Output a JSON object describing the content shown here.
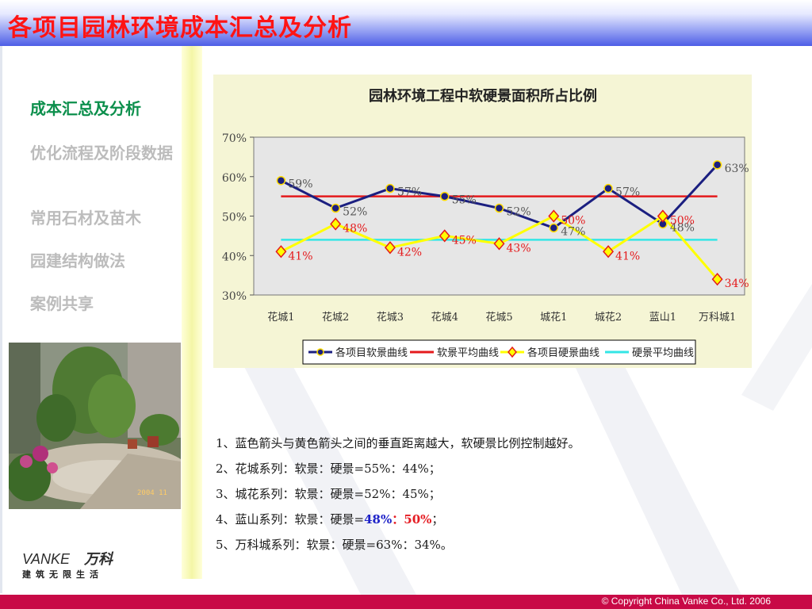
{
  "header": {
    "title": "各项目园林环境成本汇总及分析"
  },
  "nav": {
    "items": [
      {
        "label": "成本汇总及分析",
        "active": true
      },
      {
        "label": "优化流程及阶段数据",
        "active": false
      },
      {
        "label": "常用石材及苗木",
        "active": false
      },
      {
        "label": "园建结构做法",
        "active": false
      },
      {
        "label": "案例共享",
        "active": false
      }
    ]
  },
  "photo": {
    "date_stamp": "2004 11"
  },
  "logo": {
    "brand_latin": "VANKE",
    "brand_cn": "万科",
    "tagline": "建筑无限生活"
  },
  "chart_data": {
    "type": "line",
    "title": "园林环境工程中软硬景面积所占比例",
    "categories": [
      "花城1",
      "花城2",
      "花城3",
      "花城4",
      "花城5",
      "城花1",
      "城花2",
      "蓝山1",
      "万科城1"
    ],
    "ylim": [
      30,
      70
    ],
    "yticks": [
      "30%",
      "40%",
      "50%",
      "60%",
      "70%"
    ],
    "grid": false,
    "legend": "bottom",
    "series": [
      {
        "name": "各项目软景曲线",
        "values": [
          59,
          52,
          57,
          55,
          52,
          47,
          57,
          48,
          63
        ],
        "labels": [
          "59%",
          "52%",
          "57%",
          "55%",
          "52%",
          "47%",
          "57%",
          "48%",
          "63%"
        ],
        "color": "#1b1f80"
      },
      {
        "name": "软景平均曲线",
        "values": [
          55,
          55,
          55,
          55,
          55,
          55,
          55,
          55,
          55
        ],
        "color": "#e41a1c"
      },
      {
        "name": "各项目硬景曲线",
        "values": [
          41,
          48,
          42,
          45,
          43,
          50,
          41,
          50,
          34
        ],
        "labels": [
          "41%",
          "48%",
          "42%",
          "45%",
          "43%",
          "50%",
          "41%",
          "50%",
          "34%"
        ],
        "color": "#ffff00"
      },
      {
        "name": "硬景平均曲线",
        "values": [
          44,
          44,
          44,
          44,
          44,
          44,
          44,
          44,
          44
        ],
        "color": "#33e6e6"
      }
    ]
  },
  "notes": {
    "line1": "1、蓝色箭头与黄色箭头之间的垂直距离越大，软硬景比例控制越好。",
    "line2": "2、花城系列：软景：硬景=55%：44%；",
    "line3": "3、城花系列：软景：硬景=52%：45%；",
    "line4_prefix": "4、蓝山系列：软景：硬景=",
    "line4_soft": "48%",
    "line4_sep": "：",
    "line4_hard": "50%",
    "line4_suffix": "；",
    "line5": "5、万科城系列：软景：硬景=63%：34%。"
  },
  "footer": {
    "copyright": "© Copyright China Vanke Co., Ltd. 2006"
  },
  "colors": {
    "accent_red": "#ff1414",
    "nav_active": "#0c8f4c",
    "footer_bar": "#c80a46"
  }
}
